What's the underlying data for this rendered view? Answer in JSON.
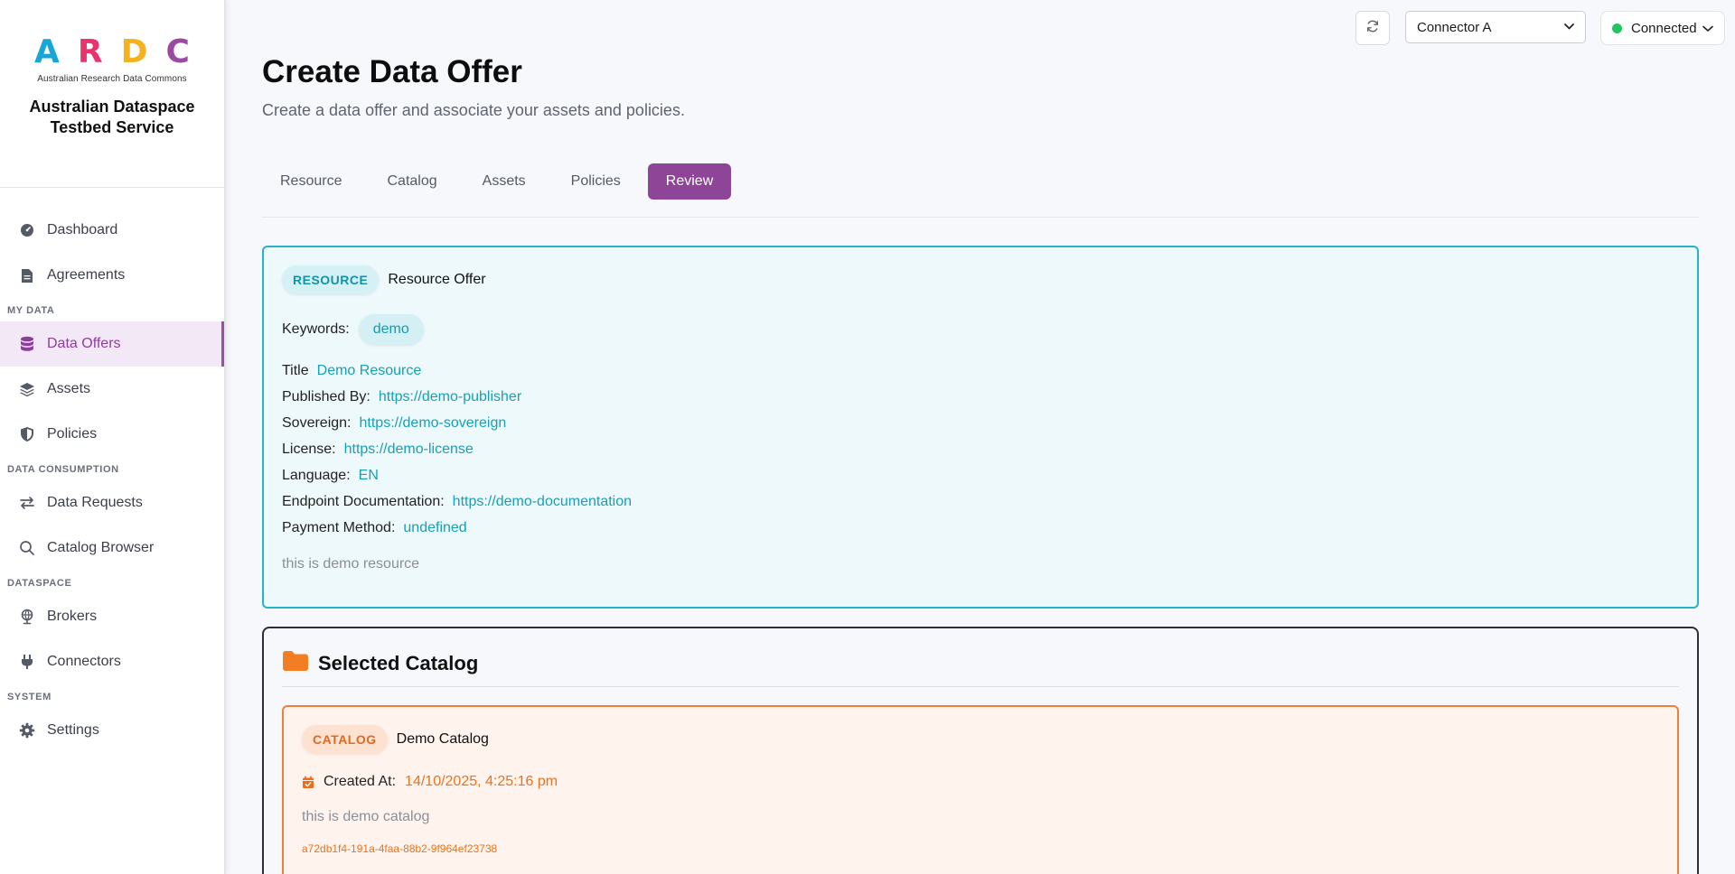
{
  "sidebar": {
    "logo_letters": [
      "A",
      "R",
      "D",
      "C"
    ],
    "logo_subtitle": "Australian Research Data Commons",
    "app_title_line1": "Australian Dataspace",
    "app_title_line2": "Testbed Service",
    "items": {
      "dashboard": "Dashboard",
      "agreements": "Agreements",
      "section_my_data": "MY DATA",
      "data_offers": "Data Offers",
      "assets": "Assets",
      "policies": "Policies",
      "section_data_consumption": "DATA CONSUMPTION",
      "data_requests": "Data Requests",
      "catalog_browser": "Catalog Browser",
      "section_dataspace": "DATASPACE",
      "brokers": "Brokers",
      "connectors": "Connectors",
      "section_system": "SYSTEM",
      "settings": "Settings"
    },
    "active_item": "Data Offers"
  },
  "topbar": {
    "connector_selected": "Connector A",
    "status": "Connected",
    "status_color": "#22c55e"
  },
  "page": {
    "title": "Create Data Offer",
    "subtitle": "Create a data offer and associate your assets and policies."
  },
  "tabs": {
    "resource": "Resource",
    "catalog": "Catalog",
    "assets": "Assets",
    "policies": "Policies",
    "review": "Review",
    "active": "Review"
  },
  "resource": {
    "badge": "RESOURCE",
    "name": "Resource Offer",
    "keywords_label": "Keywords:",
    "keyword": "demo",
    "title_label": "Title",
    "title_value": "Demo Resource",
    "published_by_label": "Published By:",
    "published_by_value": "https://demo-publisher",
    "sovereign_label": "Sovereign:",
    "sovereign_value": "https://demo-sovereign",
    "license_label": "License:",
    "license_value": "https://demo-license",
    "language_label": "Language:",
    "language_value": "EN",
    "endpoint_doc_label": "Endpoint Documentation:",
    "endpoint_doc_value": "https://demo-documentation",
    "payment_label": "Payment Method:",
    "payment_value": "undefined",
    "description": "this is demo resource"
  },
  "catalog_section": {
    "title": "Selected Catalog",
    "badge": "CATALOG",
    "name": "Demo Catalog",
    "created_label": "Created At:",
    "created_value": "14/10/2025, 4:25:16 pm",
    "description": "this is demo catalog",
    "id": "a72db1f4-191a-4faa-88b2-9f964ef23738"
  },
  "colors": {
    "accent_purple": "#8e4597",
    "resource_teal": "#26b3c8",
    "catalog_orange": "#ef7f3d"
  }
}
